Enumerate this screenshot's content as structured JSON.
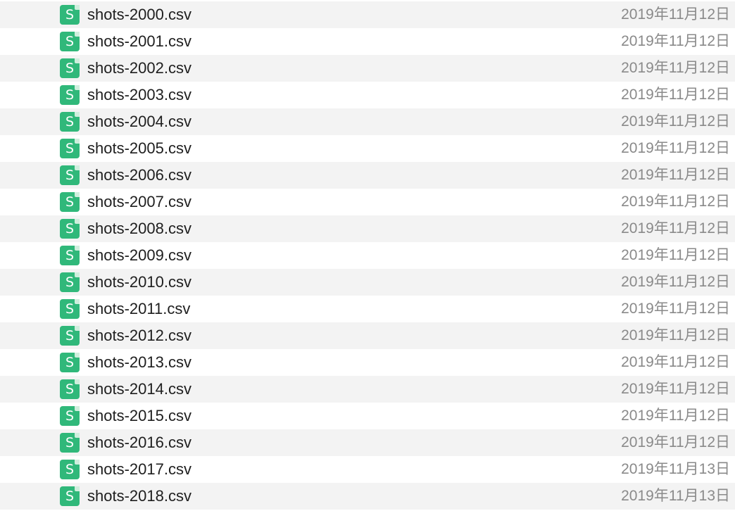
{
  "file_icon": {
    "name": "spreadsheet-icon",
    "glyph": "S",
    "color": "#30b87a"
  },
  "files": [
    {
      "name": "shots-2000.csv",
      "date": "2019年11月12日"
    },
    {
      "name": "shots-2001.csv",
      "date": "2019年11月12日"
    },
    {
      "name": "shots-2002.csv",
      "date": "2019年11月12日"
    },
    {
      "name": "shots-2003.csv",
      "date": "2019年11月12日"
    },
    {
      "name": "shots-2004.csv",
      "date": "2019年11月12日"
    },
    {
      "name": "shots-2005.csv",
      "date": "2019年11月12日"
    },
    {
      "name": "shots-2006.csv",
      "date": "2019年11月12日"
    },
    {
      "name": "shots-2007.csv",
      "date": "2019年11月12日"
    },
    {
      "name": "shots-2008.csv",
      "date": "2019年11月12日"
    },
    {
      "name": "shots-2009.csv",
      "date": "2019年11月12日"
    },
    {
      "name": "shots-2010.csv",
      "date": "2019年11月12日"
    },
    {
      "name": "shots-2011.csv",
      "date": "2019年11月12日"
    },
    {
      "name": "shots-2012.csv",
      "date": "2019年11月12日"
    },
    {
      "name": "shots-2013.csv",
      "date": "2019年11月12日"
    },
    {
      "name": "shots-2014.csv",
      "date": "2019年11月12日"
    },
    {
      "name": "shots-2015.csv",
      "date": "2019年11月12日"
    },
    {
      "name": "shots-2016.csv",
      "date": "2019年11月12日"
    },
    {
      "name": "shots-2017.csv",
      "date": "2019年11月13日"
    },
    {
      "name": "shots-2018.csv",
      "date": "2019年11月13日"
    }
  ]
}
